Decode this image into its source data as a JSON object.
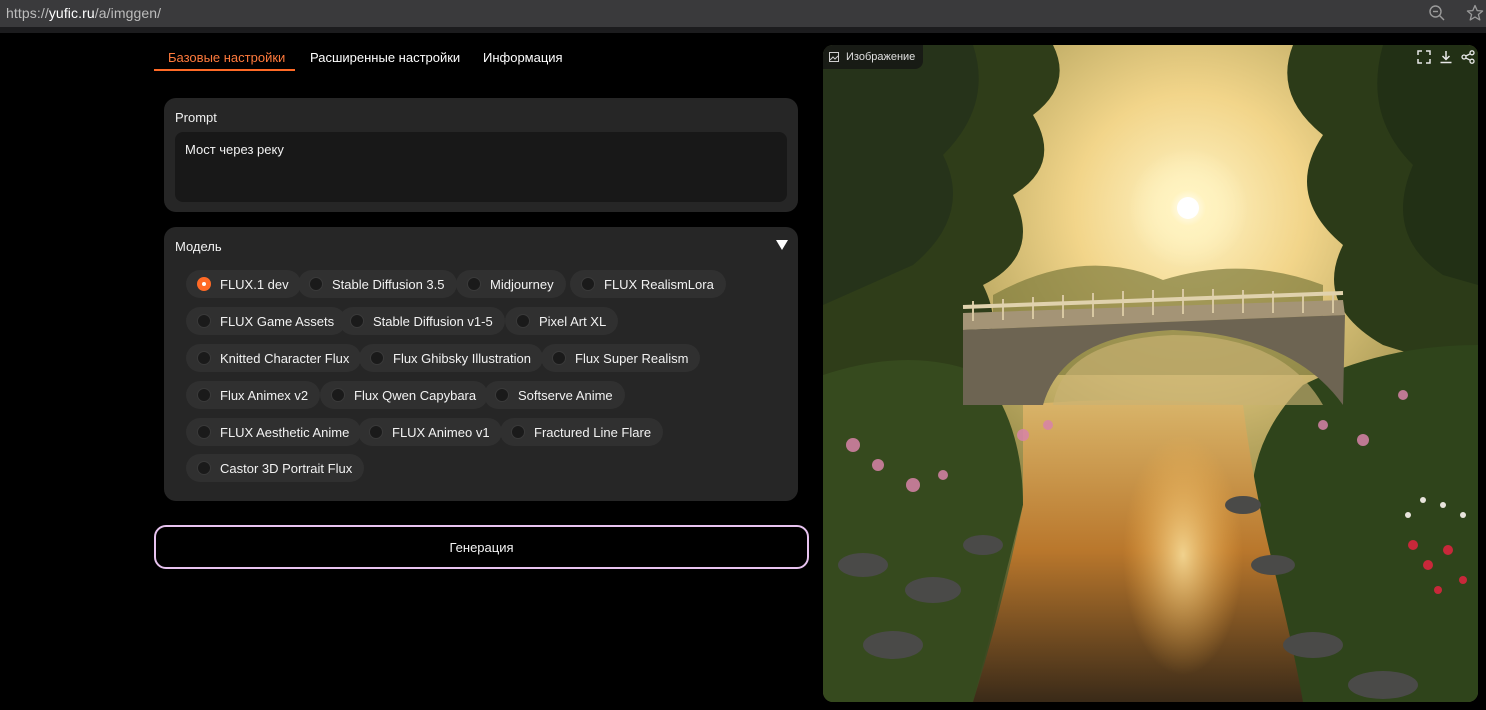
{
  "browser": {
    "url_prefix": "https://",
    "url_domain": "yufic.ru",
    "url_path": "/a/imggen/",
    "icons": [
      "zoom-out-icon",
      "star-icon"
    ]
  },
  "tabs": [
    {
      "label": "Базовые настройки",
      "active": true
    },
    {
      "label": "Расширенные настройки",
      "active": false
    },
    {
      "label": "Информация",
      "active": false
    }
  ],
  "prompt": {
    "label": "Prompt",
    "value": "Мост через реку"
  },
  "model": {
    "label": "Модель",
    "selected": "FLUX.1 dev",
    "options": [
      "FLUX.1 dev",
      "Stable Diffusion 3.5",
      "Midjourney",
      "FLUX RealismLora",
      "FLUX Game Assets",
      "Stable Diffusion v1-5",
      "Pixel Art XL",
      "Knitted Character Flux",
      "Flux Ghibsky Illustration",
      "Flux Super Realism",
      "Flux Animex v2",
      "Flux Qwen Capybara",
      "Softserve Anime",
      "FLUX Aesthetic Anime",
      "FLUX Animeo v1",
      "Fractured Line Flare",
      "Castor 3D Portrait Flux"
    ]
  },
  "generate_label": "Генерация",
  "image_panel": {
    "label": "Изображение",
    "icons": [
      "fullscreen-icon",
      "download-icon",
      "share-icon"
    ]
  },
  "colors": {
    "accent": "#ff6a26",
    "button_border": "#e7c3ef",
    "block_bg": "#262626"
  }
}
